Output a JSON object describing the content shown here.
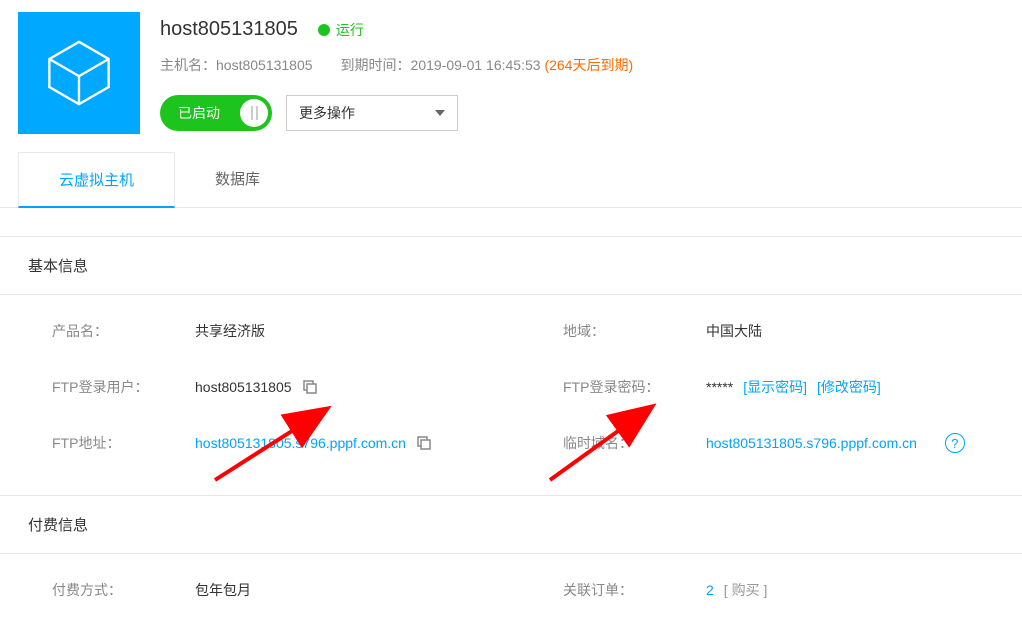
{
  "header": {
    "title": "host805131805",
    "status": "运行",
    "hostname_label": "主机名：",
    "hostname_value": "host805131805",
    "expire_label": "到期时间：",
    "expire_value": "2019-09-01 16:45:53",
    "expire_warn": "(264天后到期)",
    "toggle_label": "已启动",
    "more_actions": "更多操作"
  },
  "tabs": {
    "tab1": "云虚拟主机",
    "tab2": "数据库"
  },
  "basic_section": {
    "title": "基本信息",
    "product_name_label": "产品名：",
    "product_name_value": "共享经济版",
    "region_label": "地域：",
    "region_value": "中国大陆",
    "ftp_user_label": "FTP登录用户：",
    "ftp_user_value": "host805131805",
    "ftp_pass_label": "FTP登录密码：",
    "ftp_pass_value": "*****",
    "show_pass": "[显示密码]",
    "change_pass": "[修改密码]",
    "ftp_addr_label": "FTP地址：",
    "ftp_addr_value": "host805131805.s796.pppf.com.cn",
    "temp_domain_label": "临时域名：",
    "temp_domain_value": "host805131805.s796.pppf.com.cn"
  },
  "payment_section": {
    "title": "付费信息",
    "pay_method_label": "付费方式：",
    "pay_method_value": "包年包月",
    "order_label": "关联订单：",
    "order_count": "2",
    "order_tag": " [ 购买 ]"
  }
}
